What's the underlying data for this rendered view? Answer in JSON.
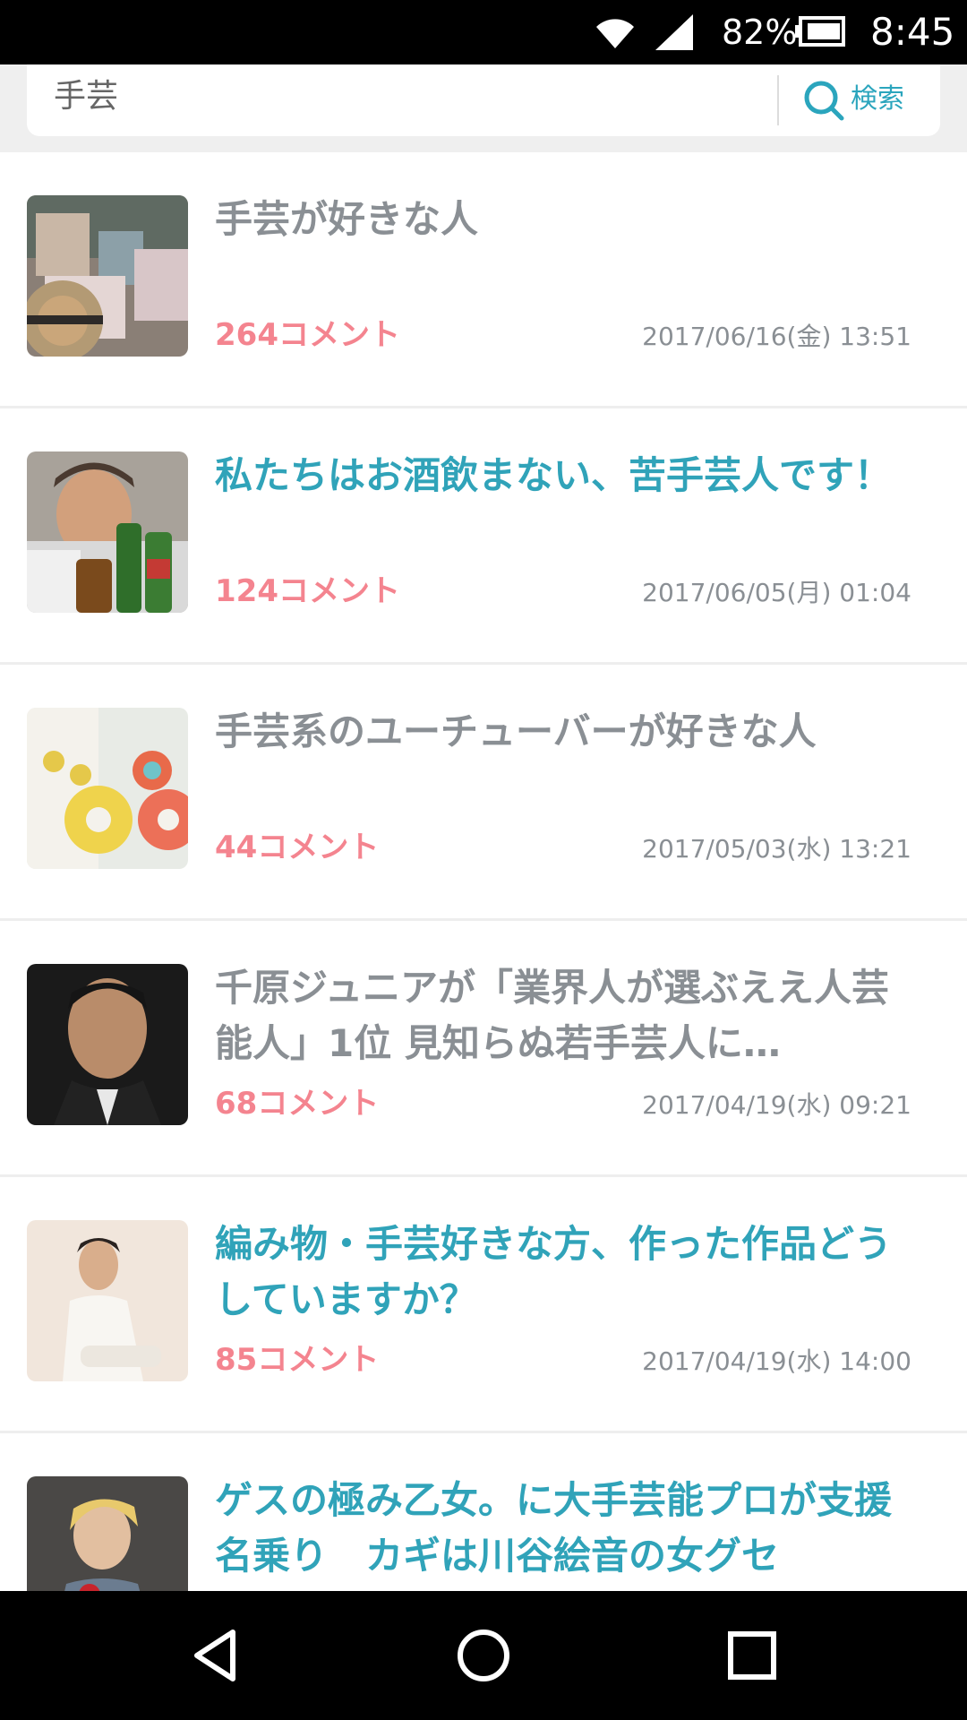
{
  "status_bar": {
    "battery_percent": "82%",
    "time": "8:45"
  },
  "search": {
    "query": "手芸",
    "button_label": "検索"
  },
  "results": [
    {
      "title": "手芸が好きな人",
      "comments": "264コメント",
      "date": "2017/06/16(金) 13:51",
      "title_style": "gray",
      "thumb": "fabric-crafts-thumbnail"
    },
    {
      "title": "私たちはお酒飲まない、苦手芸人です！",
      "comments": "124コメント",
      "date": "2017/06/05(月) 01:04",
      "title_style": "teal",
      "thumb": "man-with-bottles-thumbnail"
    },
    {
      "title": "手芸系のユーチューバーが好きな人",
      "comments": "44コメント",
      "date": "2017/05/03(水) 13:21",
      "title_style": "gray",
      "thumb": "crochet-flowers-thumbnail"
    },
    {
      "title": "千原ジュニアが「業界人が選ぶええ人芸能人」1位 見知らぬ若手芸人に…",
      "comments": "68コメント",
      "date": "2017/04/19(水) 09:21",
      "title_style": "gray",
      "thumb": "comedian-portrait-thumbnail"
    },
    {
      "title": "編み物・手芸好きな方、作った作品どうしていますか？",
      "comments": "85コメント",
      "date": "2017/04/19(水) 14:00",
      "title_style": "teal",
      "thumb": "man-knit-sweater-thumbnail"
    },
    {
      "title": "ゲスの極み乙女。に大手芸能プロが支援名乗り　カギは川谷絵音の女グセ",
      "comments": "",
      "date": "",
      "title_style": "teal",
      "thumb": "musician-portrait-thumbnail"
    }
  ],
  "colors": {
    "accent_teal": "#30a3b9",
    "comment_pink": "#f4848f",
    "muted_gray": "#8a8f94"
  },
  "nav_icons": [
    "back-icon",
    "home-icon",
    "recents-icon"
  ]
}
